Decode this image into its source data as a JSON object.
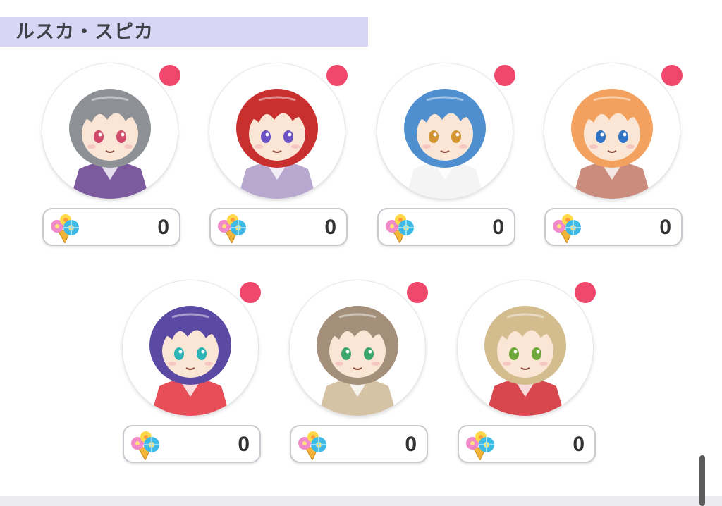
{
  "section": {
    "title": "ルスカ・スピカ"
  },
  "characters": [
    {
      "hair": "#8d9095",
      "outfit": "#7d5a9e",
      "eyes": "#d04a6a",
      "count": "0",
      "new": true
    },
    {
      "hair": "#c8302f",
      "outfit": "#b8a8cf",
      "eyes": "#6a52c4",
      "count": "0",
      "new": true
    },
    {
      "hair": "#4f8fcf",
      "outfit": "#f4f4f4",
      "eyes": "#d19430",
      "count": "0",
      "new": true
    },
    {
      "hair": "#f2a25e",
      "outfit": "#c98c7d",
      "eyes": "#2f74c6",
      "count": "0",
      "new": true
    },
    {
      "hair": "#5b4aa3",
      "outfit": "#e84e58",
      "eyes": "#2bb3b5",
      "count": "0",
      "new": true
    },
    {
      "hair": "#a4907a",
      "outfit": "#d6c3a6",
      "eyes": "#3ca66a",
      "count": "0",
      "new": true
    },
    {
      "hair": "#d3bc8e",
      "outfit": "#d9474e",
      "eyes": "#6fa83a",
      "count": "0",
      "new": true
    }
  ],
  "colors": {
    "header_bg": "#d9d6f5",
    "badge": "#f0486c",
    "pill_border": "#c9c9cf"
  },
  "icons": {
    "gift": "flower-bouquet-icon",
    "badge": "new-notification-dot"
  }
}
